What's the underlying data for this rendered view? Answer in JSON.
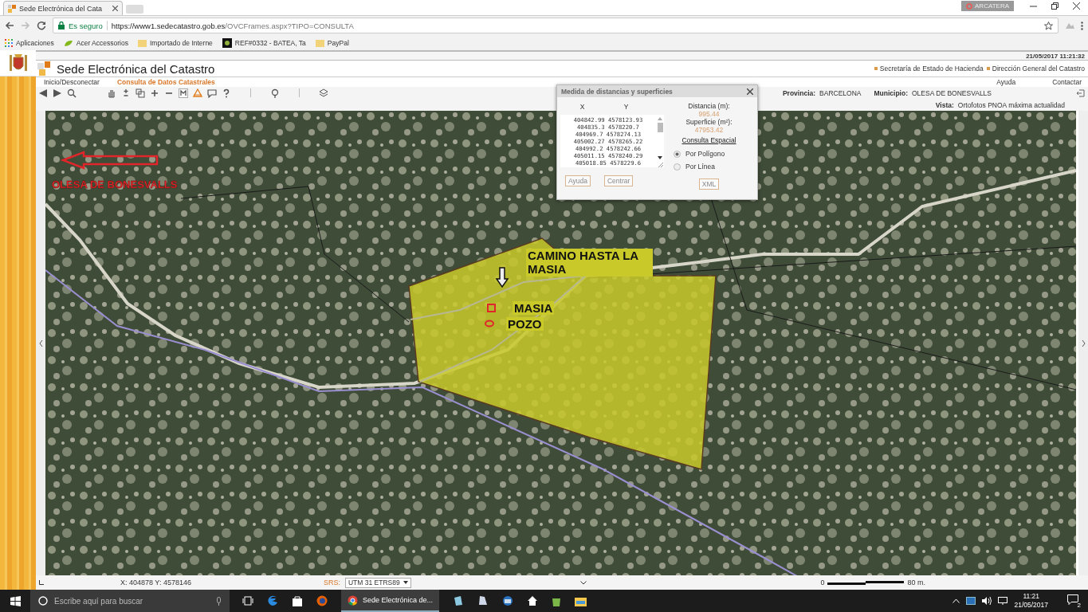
{
  "browser": {
    "tab_title": "Sede Electrónica del Cata",
    "security": "Es seguro",
    "url_host": "https://www1.sedecatastro.gob.es",
    "url_path": "/OVCFrames.aspx?TIPO=CONSULTA",
    "profile": "ARCATERA",
    "bookmarks": [
      {
        "label": "Aplicaciones",
        "kind": "apps"
      },
      {
        "label": "Acer Accessorios",
        "kind": "acer"
      },
      {
        "label": "Importado de Interne",
        "kind": "folder"
      },
      {
        "label": "REF#0332 - BATEA, Ta",
        "kind": "page"
      },
      {
        "label": "PayPal",
        "kind": "folder"
      }
    ]
  },
  "site": {
    "datetime": "21/05/2017  11:21:32",
    "title": "Sede Electrónica del Catastro",
    "header_links": [
      "Secretaría de Estado de Hacienda",
      "Dirección General del Catastro"
    ],
    "nav": [
      {
        "label": "Inicio/Desconectar",
        "selected": false
      },
      {
        "label": "Consulta de Datos Catastrales",
        "selected": true
      }
    ],
    "help_links": [
      "Ayuda",
      "Contactar"
    ]
  },
  "location": {
    "provincia_label": "Provincia:",
    "provincia": "BARCELONA",
    "municipio_label": "Municipio:",
    "municipio": "OLESA DE BONESVALLS",
    "vista_label": "Vista:",
    "vista": "Ortofotos PNOA máxima actualidad"
  },
  "measure_dialog": {
    "title": "Medida de distancias y superficies",
    "columns": [
      "X",
      "Y"
    ],
    "rows": [
      "404842.99 4578123.93",
      "404835.3 4578220.7",
      "404969.7 4578274.13",
      "405002.27 4578265.22",
      "404992.2 4578242.66",
      "405011.15 4578240.29",
      "405018.85 4578229.6"
    ],
    "distancia_label": "Distancia (m):",
    "distancia": "995.44",
    "superficie_label": "Superficie (m²):",
    "superficie": "47953.42",
    "consulta_label": "Consulta Espacial",
    "options": [
      {
        "label": "Por Polígono",
        "selected": true
      },
      {
        "label": "Por Línea",
        "selected": false
      }
    ],
    "buttons": [
      "Ayuda",
      "Centrar"
    ],
    "xml_button": "XML"
  },
  "map": {
    "annotations": [
      {
        "text": "OLESA DE BONESVALLS",
        "kind": "place"
      },
      {
        "text": "CAMINO HASTA LA MASIA",
        "kind": "note"
      },
      {
        "text": "MASIA",
        "kind": "note"
      },
      {
        "text": "POZO",
        "kind": "note"
      }
    ]
  },
  "status": {
    "coords": "X: 404878 Y: 4578146",
    "srs_label": "SRS:",
    "srs": "UTM 31 ETRS89",
    "scale_start": "0",
    "scale_end": "80 m."
  },
  "taskbar": {
    "search_placeholder": "Escribe aquí para buscar",
    "active_app": "Sede Electrónica de...",
    "time": "11:21",
    "date": "21/05/2017",
    "notifications": "2"
  }
}
